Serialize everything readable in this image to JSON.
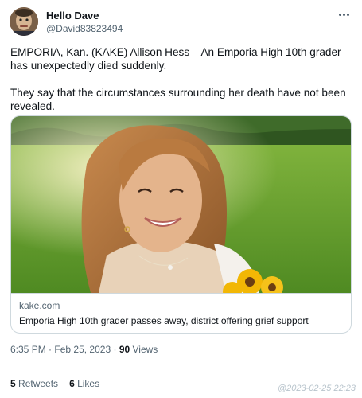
{
  "author": {
    "display_name": "Hello Dave",
    "handle": "@David83823494",
    "avatar_icon": "user-avatar-icon"
  },
  "more_icon": "more-horizontal-icon",
  "tweet": {
    "paragraphs": [
      "EMPORIA, Kan. (KAKE) Allison Hess – An Emporia High 10th grader has unexpectedly died suddenly.",
      "They say that the circumstances surrounding her death have not been revealed."
    ]
  },
  "card": {
    "domain": "kake.com",
    "title": "Emporia High 10th grader passes away, district offering grief support",
    "image_description_icon": "photo-smiling-girl-in-field"
  },
  "meta": {
    "time": "6:35 PM",
    "separator1": "·",
    "date": "Feb 25, 2023",
    "separator2": "·",
    "views_count": "90",
    "views_label": "Views"
  },
  "stats": {
    "retweets_count": "5",
    "retweets_label": "Retweets",
    "likes_count": "6",
    "likes_label": "Likes"
  },
  "watermark": "@2023-02-25 22:23",
  "colors": {
    "text_primary": "#0f1419",
    "text_secondary": "#536471",
    "border": "#cfd9de",
    "grass": "#5a9a2a",
    "sunflower": "#f2b705"
  }
}
